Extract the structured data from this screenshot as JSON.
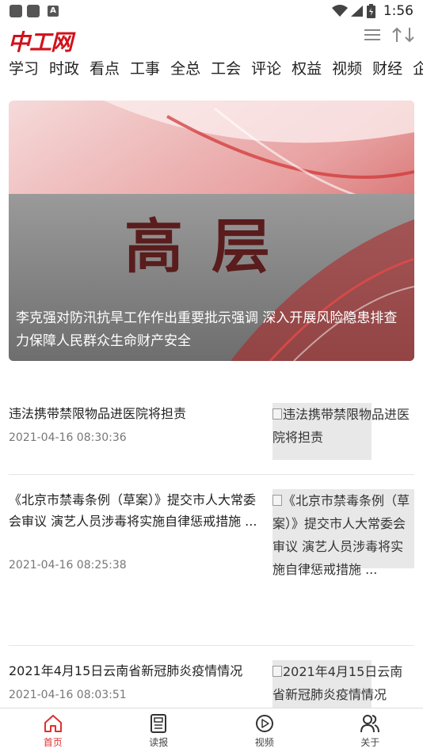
{
  "status_bar": {
    "time": "1:56",
    "badge": "A"
  },
  "header": {
    "logo": "中工网"
  },
  "tabs": [
    "学习",
    "时政",
    "看点",
    "工事",
    "全总",
    "工会",
    "评论",
    "权益",
    "视频",
    "财经",
    "企"
  ],
  "banner": {
    "word": "高层",
    "caption": "李克强对防汛抗旱工作作出重要批示强调 深入开展风险隐患排查 力保障人民群众生命财产安全"
  },
  "news": [
    {
      "title": "违法携带禁限物品进医院将担责",
      "time": "2021-04-16 08:30:36",
      "thumb_alt": "违法携带禁限物品进医院将担责"
    },
    {
      "title": "《北京市禁毒条例（草案）》提交市人大常委会审议 演艺人员涉毒将实施自律惩戒措施 ...",
      "time": "2021-04-16 08:25:38",
      "thumb_alt": "《北京市禁毒条例（草案）》提交市人大常委会审议 演艺人员涉毒将实施自律惩戒措施 ..."
    },
    {
      "title": "2021年4月15日云南省新冠肺炎疫情情况",
      "time": "2021-04-16 08:03:51",
      "thumb_alt": "2021年4月15日云南省新冠肺炎疫情情况"
    }
  ],
  "bottom_nav": [
    {
      "label": "首页",
      "icon": "home-icon",
      "active": true
    },
    {
      "label": "读报",
      "icon": "newspaper-icon",
      "active": false
    },
    {
      "label": "视频",
      "icon": "video-icon",
      "active": false
    },
    {
      "label": "关于",
      "icon": "people-icon",
      "active": false
    }
  ],
  "colors": {
    "brand": "#d0121b",
    "active_nav": "#e0302f"
  }
}
